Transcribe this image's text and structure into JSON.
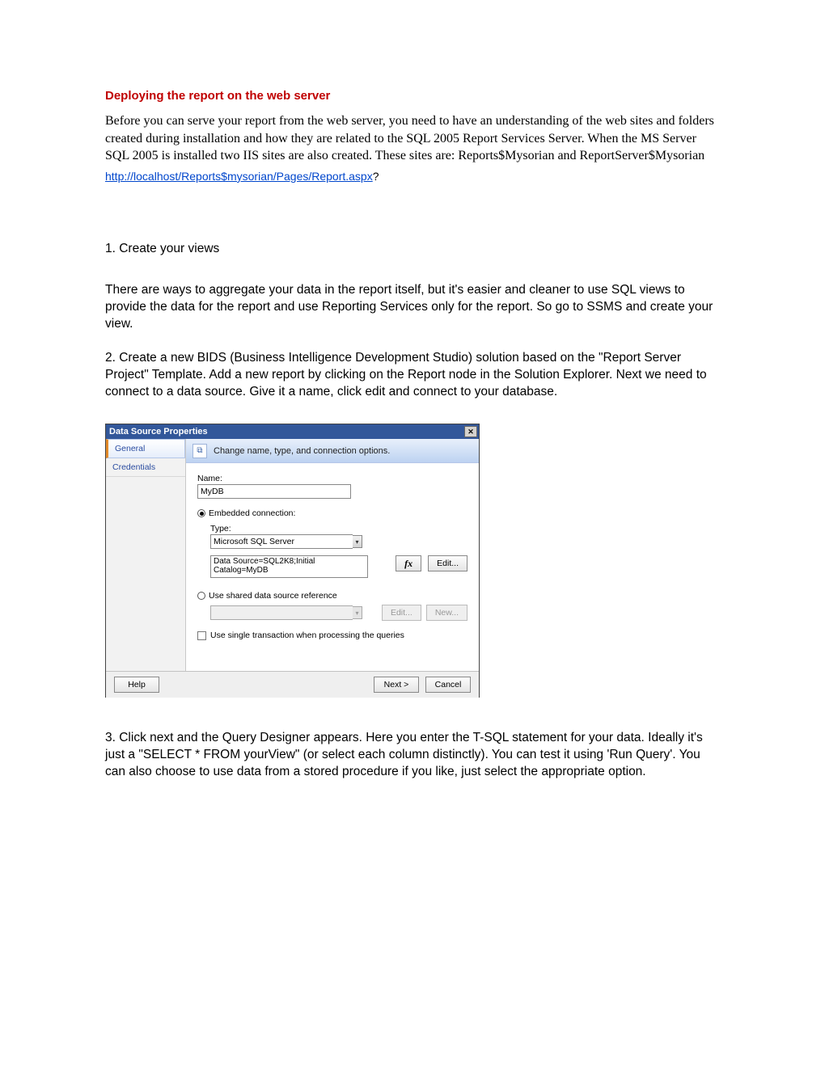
{
  "heading": "Deploying the report on the web server",
  "intro": "Before you can serve your report from the web server, you need to have an understanding of the web sites and folders created during installation and how they are related to the SQL 2005 Report Services Server.  When the MS Server SQL 2005 is installed two IIS sites are also created.  These sites are: Reports$Mysorian and ReportServer$Mysorian",
  "link_text": "http://localhost/Reports$mysorian/Pages/Report.aspx",
  "link_q": "?",
  "step1_title": "1. Create your views",
  "step1_body": "There are ways to aggregate your data in the report itself, but it's easier and cleaner to use SQL views to provide the data for the report and use Reporting Services only for the report. So go to SSMS and create your view.",
  "step2_body": "2. Create a new BIDS (Business Intelligence Development Studio) solution based on the \"Report Server Project\" Template. Add a new report by clicking on the Report node in the Solution Explorer. Next we need to connect to a data source. Give it a name, click edit and connect to your database.",
  "step3_body": "3. Click next and the Query Designer appears. Here you enter the T-SQL statement for your data. Ideally it's just a \"SELECT * FROM yourView\" (or select each column distinctly). You can test it using 'Run Query'. You can also choose to use data from a stored procedure if you like, just select the appropriate option.",
  "dialog": {
    "title": "Data Source Properties",
    "close_x": "✕",
    "tabs": {
      "general": "General",
      "credentials": "Credentials"
    },
    "banner_icon": "⧉",
    "banner_text": "Change name, type, and connection options.",
    "name_label": "Name:",
    "name_value": "MyDB",
    "embedded_label": "Embedded connection:",
    "type_label": "Type:",
    "type_value": "Microsoft SQL Server",
    "dd_glyph": "▾",
    "conn_value": "Data Source=SQL2K8;Initial Catalog=MyDB",
    "fx_label": "fx",
    "edit_label": "Edit...",
    "shared_label": "Use shared data source reference",
    "new_label": "New...",
    "single_txn_label": "Use single transaction when processing the queries",
    "help_label": "Help",
    "next_label": "Next >",
    "cancel_label": "Cancel"
  }
}
